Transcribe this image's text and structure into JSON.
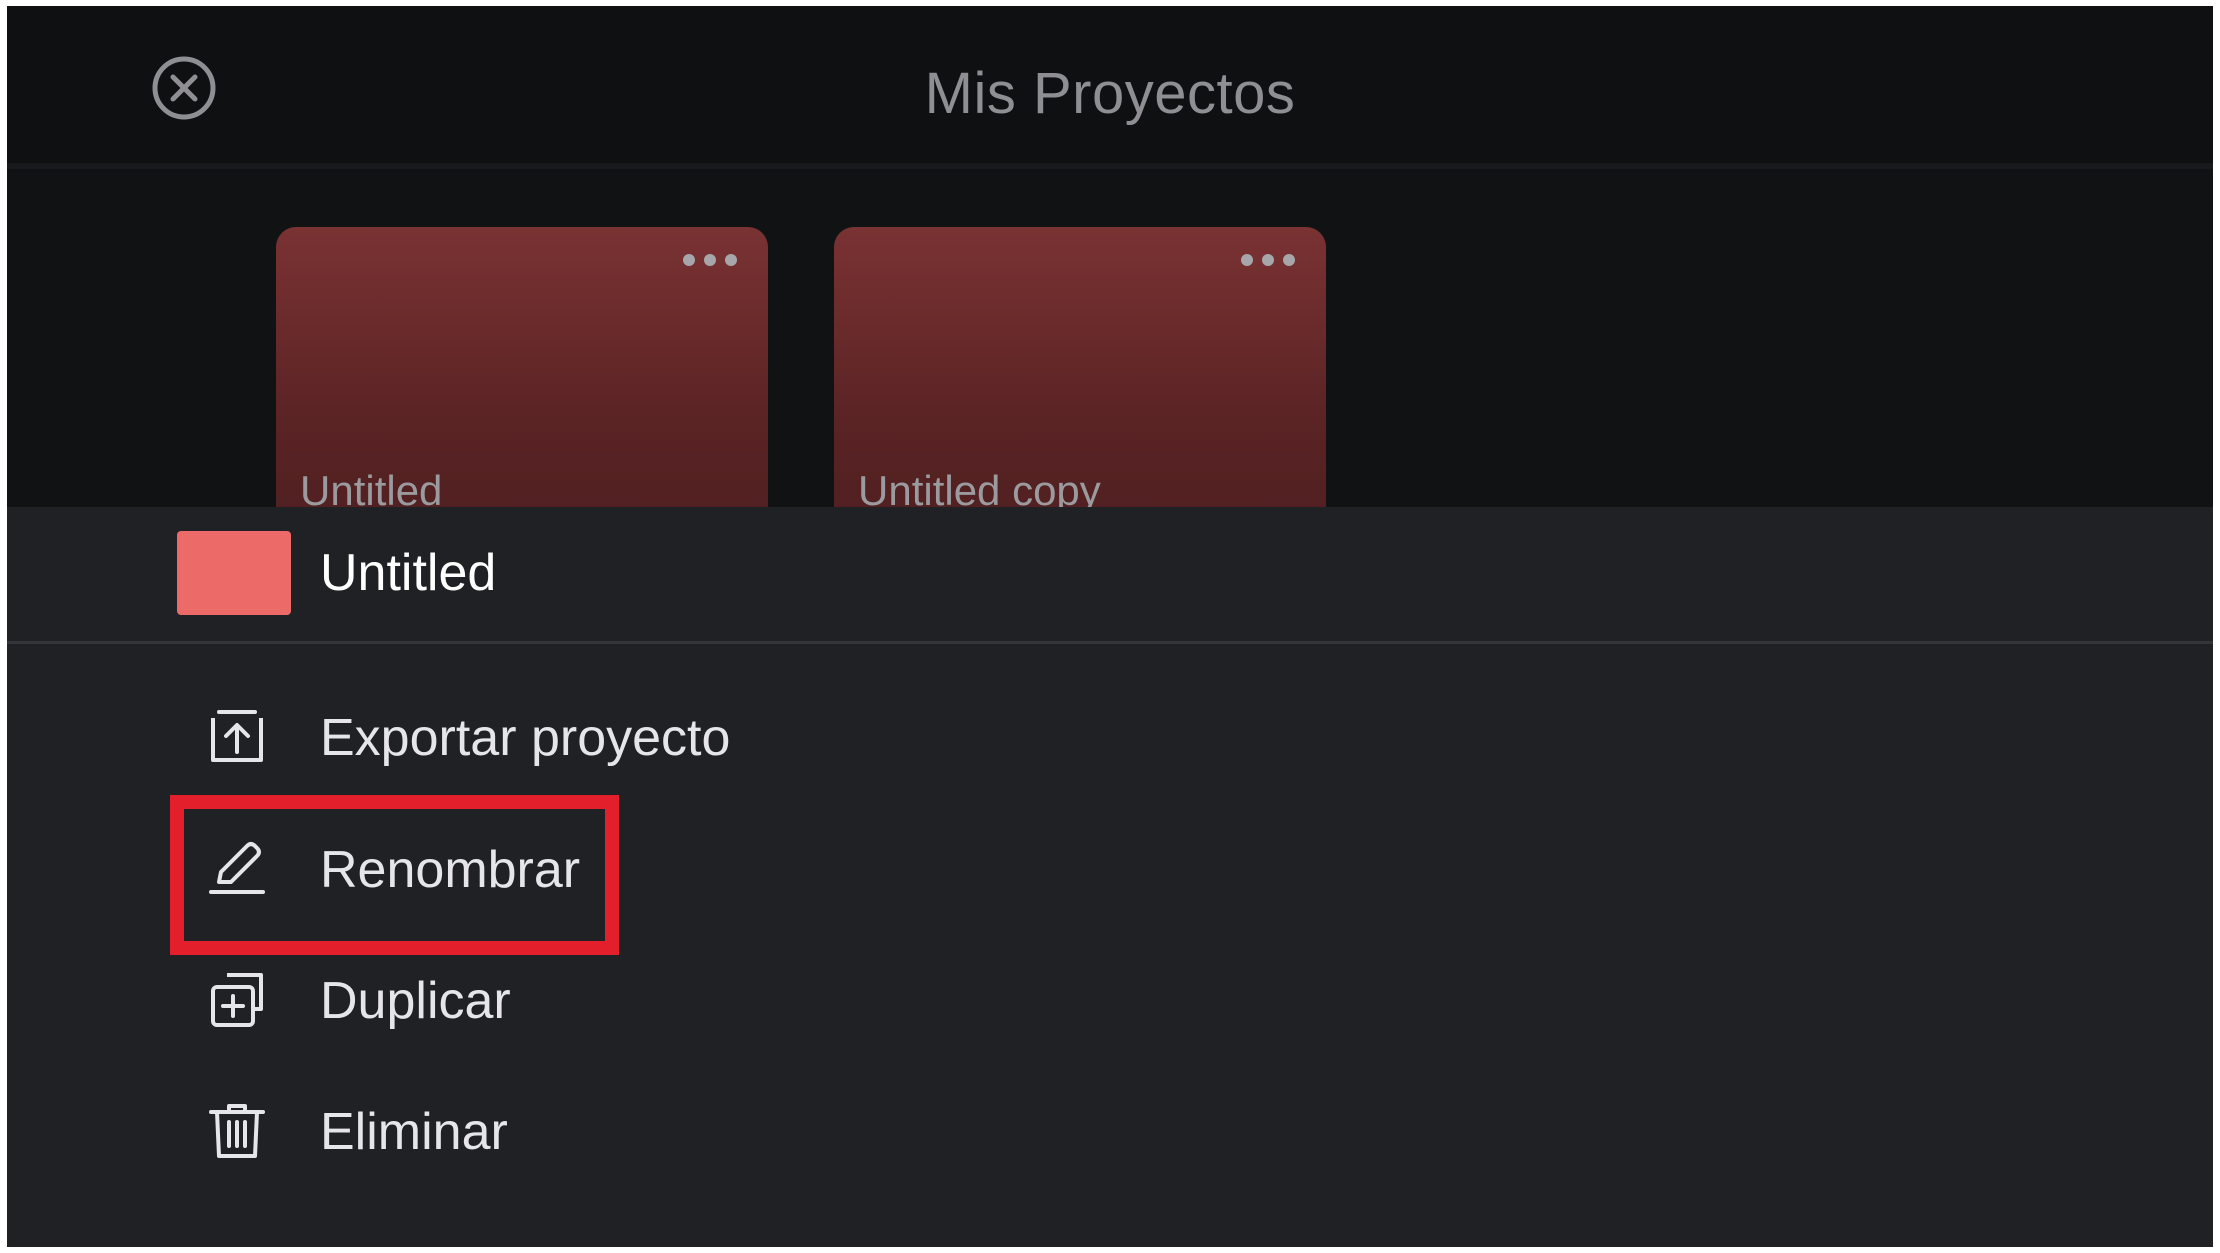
{
  "header": {
    "title": "Mis Proyectos"
  },
  "projects": [
    {
      "name": "Untitled"
    },
    {
      "name": "Untitled copy"
    }
  ],
  "sheet": {
    "project_name": "Untitled",
    "swatch_color": "#ec6a67",
    "items": [
      {
        "label": "Exportar proyecto",
        "icon": "export-icon"
      },
      {
        "label": "Renombrar",
        "icon": "pencil-icon"
      },
      {
        "label": "Duplicar",
        "icon": "duplicate-icon"
      },
      {
        "label": "Eliminar",
        "icon": "trash-icon"
      }
    ]
  },
  "colors": {
    "highlight": "#e21f2a",
    "card": "#6a2a2b",
    "sheet_bg": "#202124"
  }
}
